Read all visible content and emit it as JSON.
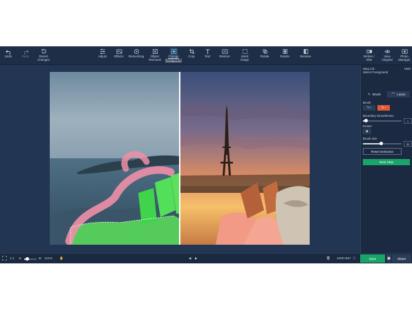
{
  "toolbar": {
    "undo": "Undo",
    "redo": "Redo",
    "revert1": "Revert",
    "revert2": "Changes",
    "adjust": "Adjust",
    "effects": "Effects",
    "retouching": "Retouching",
    "object1": "Object",
    "object2": "Removal",
    "change1": "Change",
    "change2": "Background",
    "crop": "Crop",
    "text": "Text",
    "restore": "Restore",
    "insert1": "Insert",
    "insert2": "Image",
    "rotate": "Rotate",
    "resize": "Resize",
    "denoise": "Denoise",
    "before1": "Before /",
    "before2": "After",
    "view1": "View",
    "view2": "Original",
    "photo1": "Photo",
    "photo2": "Manager"
  },
  "sidebar": {
    "step": "Step 1/3:",
    "step_title": "Select Foreground",
    "hide": "Hide",
    "brush_tab": "Brush",
    "lasso_tab": "Lasso",
    "brush_label": "Brush",
    "boundary_label": "Boundary Smoothness",
    "boundary_value": "1",
    "eraser_label": "Eraser",
    "brush_size_label": "Brush size",
    "brush_size_value": "32",
    "reset_button": "Reset Selection",
    "next_button": "Next Step"
  },
  "statusbar": {
    "fit": "1:1",
    "zoom": "121%",
    "dimensions": "1000×667",
    "save": "Save",
    "share": "Share"
  },
  "colors": {
    "accent": "#19a46a",
    "active_tool": "#e05a3a",
    "background": "#1d2d45"
  }
}
